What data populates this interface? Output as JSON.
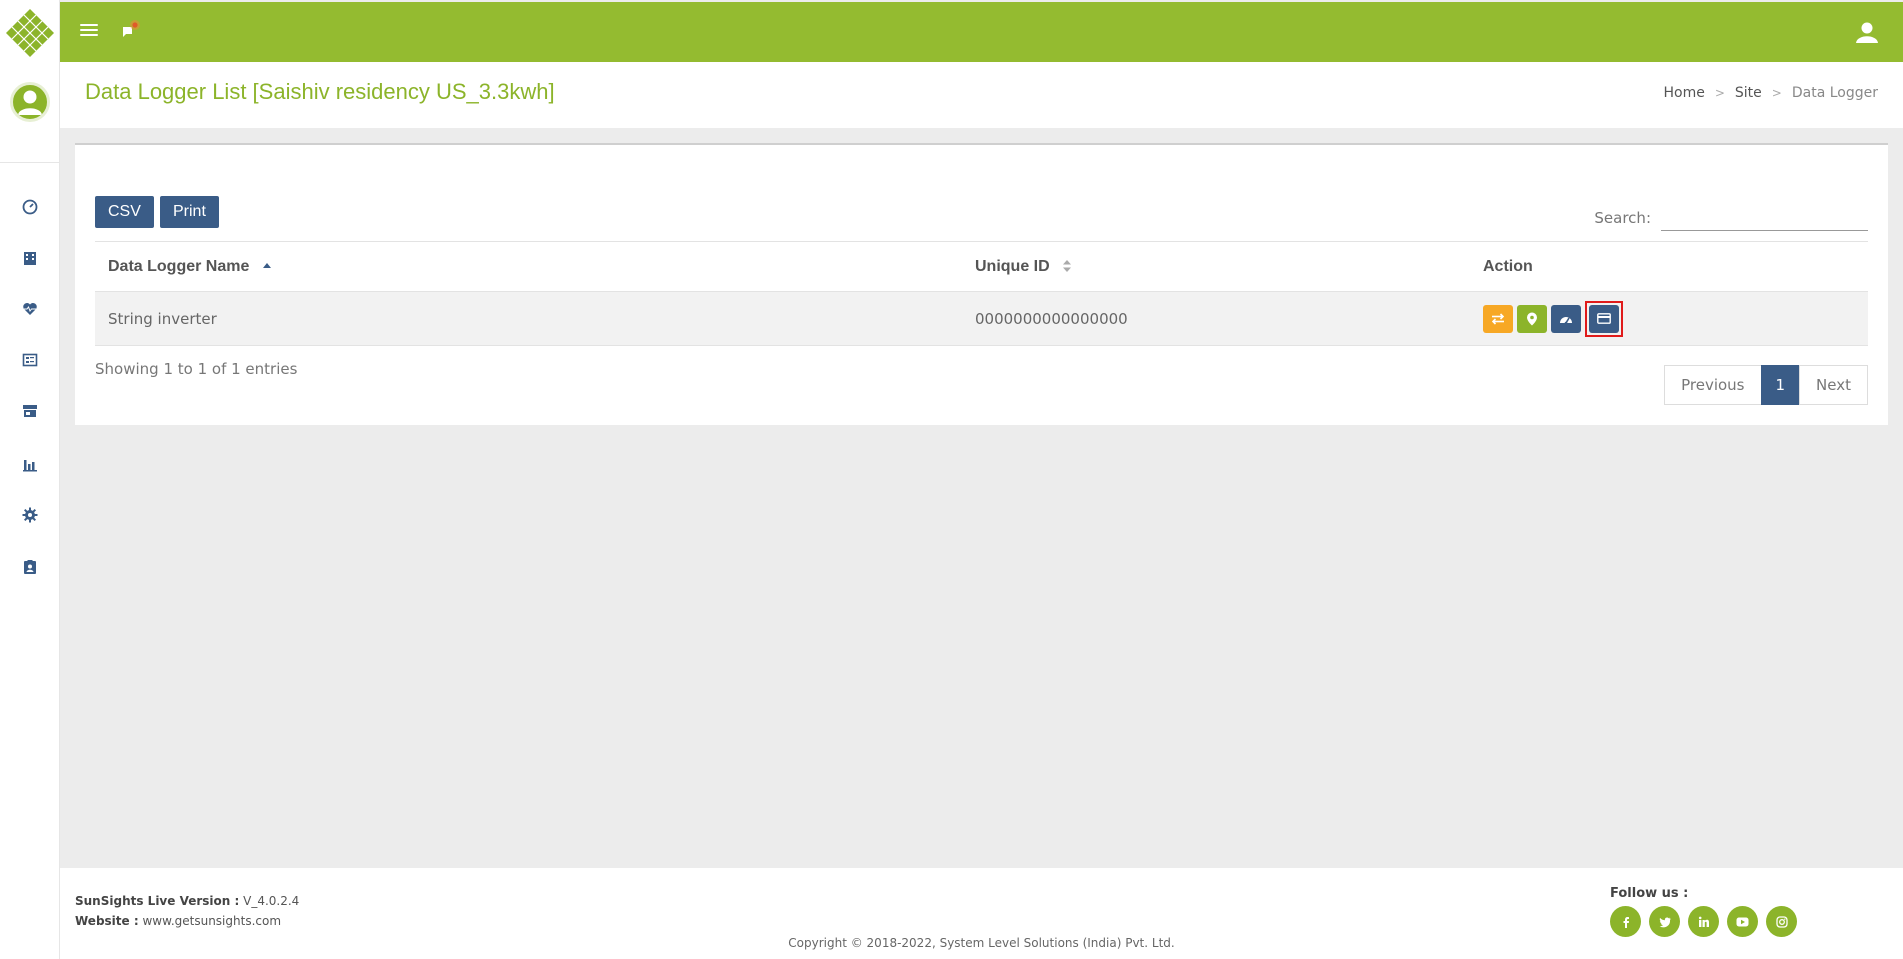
{
  "colors": {
    "brand_green": "#94bb30",
    "navy": "#3a5c87",
    "orange": "#f7a825",
    "highlight_red": "#e01b1b"
  },
  "header": {
    "title": "Data Logger List [Saishiv residency US_3.3kwh]",
    "breadcrumb": {
      "home": "Home",
      "site": "Site",
      "current": "Data Logger",
      "separator": ">"
    }
  },
  "topbar": {
    "icons": [
      "menu-icon",
      "notification-flag-icon",
      "user-icon"
    ]
  },
  "sidebar": {
    "icons": [
      "dashboard-icon",
      "building-icon",
      "heart-pulse-icon",
      "list-report-icon",
      "store-icon",
      "bar-chart-icon",
      "gear-icon",
      "clipboard-user-icon"
    ]
  },
  "table": {
    "buttons": {
      "csv": "CSV",
      "print": "Print"
    },
    "search_label": "Search:",
    "search_value": "",
    "columns": [
      "Data Logger Name",
      "Unique ID",
      "Action"
    ],
    "rows": [
      {
        "name": "String inverter",
        "unique_id": "0000000000000000"
      }
    ],
    "row_actions": [
      "transfer-icon",
      "map-pin-icon",
      "gauge-icon",
      "card-icon"
    ],
    "info": "Showing 1 to 1 of 1 entries",
    "pagination": {
      "previous": "Previous",
      "current_page": "1",
      "next": "Next"
    }
  },
  "footer": {
    "version_label": "SunSights Live Version :",
    "version_value": "V_4.0.2.4",
    "website_label": "Website :",
    "website_value": "www.getsunsights.com",
    "follow_label": "Follow us :",
    "social_icons": [
      "facebook-icon",
      "twitter-icon",
      "linkedin-icon",
      "youtube-icon",
      "instagram-icon"
    ],
    "copyright": "Copyright © 2018-2022, System Level Solutions (India) Pvt. Ltd."
  }
}
